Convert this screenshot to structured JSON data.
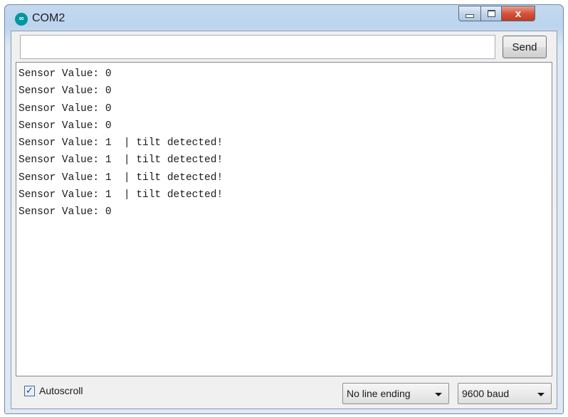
{
  "window": {
    "title": "COM2",
    "app_icon": "arduino-logo-icon",
    "app_icon_glyph": "∞"
  },
  "controls": {
    "close_glyph": "x"
  },
  "send": {
    "input_value": "",
    "button_label": "Send"
  },
  "output": {
    "lines": [
      "Sensor Value: 0",
      "Sensor Value: 0",
      "Sensor Value: 0",
      "Sensor Value: 0",
      "Sensor Value: 1  | tilt detected!",
      "Sensor Value: 1  | tilt detected!",
      "Sensor Value: 1  | tilt detected!",
      "Sensor Value: 1  | tilt detected!",
      "Sensor Value: 0"
    ]
  },
  "footer": {
    "autoscroll_label": "Autoscroll",
    "autoscroll_checked": true,
    "line_ending": "No line ending",
    "baud": "9600 baud"
  },
  "colors": {
    "accent_close": "#c13a22",
    "app_icon": "#00979c"
  }
}
